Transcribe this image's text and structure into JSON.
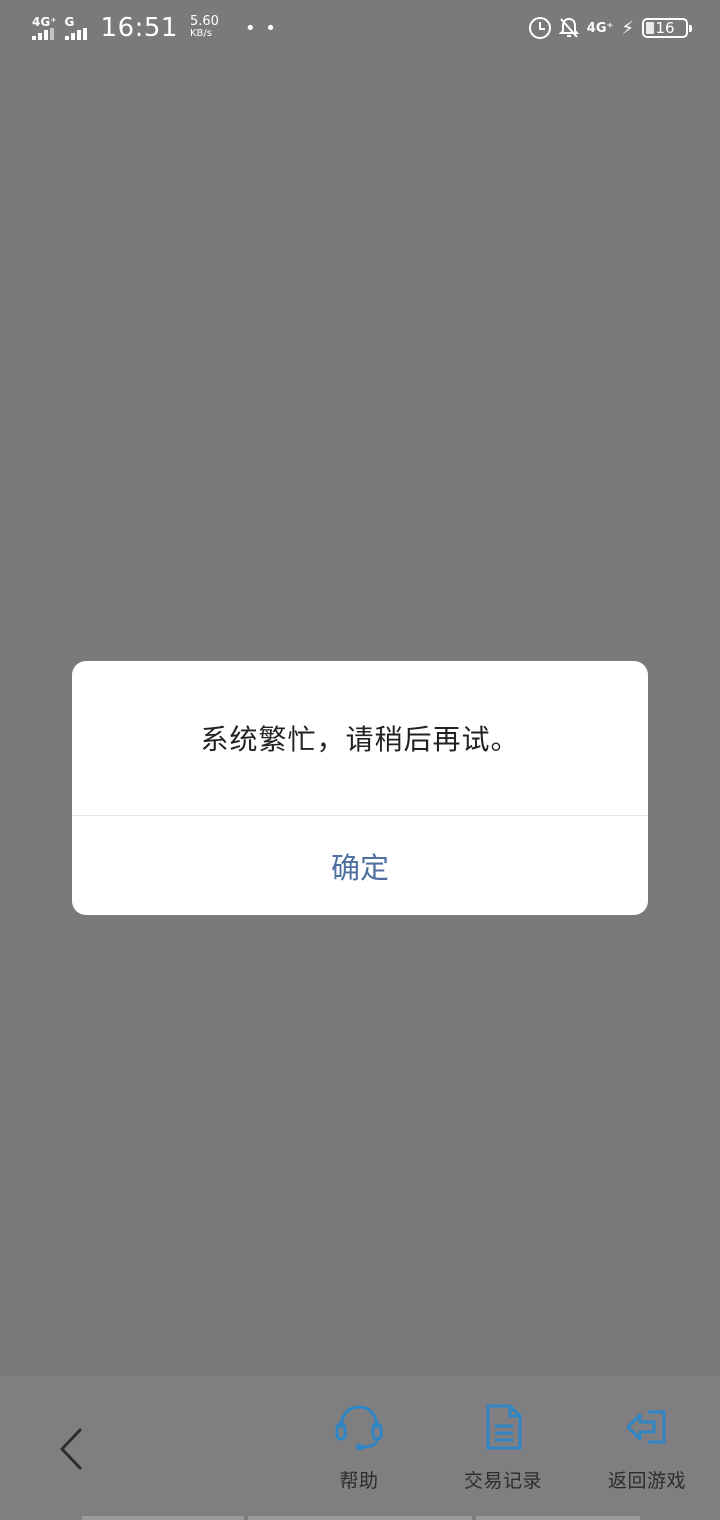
{
  "status_bar": {
    "network_primary": "4G⁺",
    "network_secondary": "G",
    "time": "16:51",
    "speed_value": "5.60",
    "speed_unit": "KB/s",
    "more": "• •",
    "network_right": "4G⁺",
    "battery_level": "16"
  },
  "dialog": {
    "message": "系统繁忙，请稍后再试。",
    "confirm_label": "确定"
  },
  "bottom_nav": {
    "items": [
      {
        "label": "帮助",
        "icon": "headset-icon"
      },
      {
        "label": "交易记录",
        "icon": "document-icon"
      },
      {
        "label": "返回游戏",
        "icon": "exit-arrow-icon"
      }
    ]
  },
  "colors": {
    "overlay": "#7a7a7c",
    "dialog_bg": "#ffffff",
    "confirm_text": "#4e6f9f",
    "nav_icon": "#2f86c6"
  }
}
